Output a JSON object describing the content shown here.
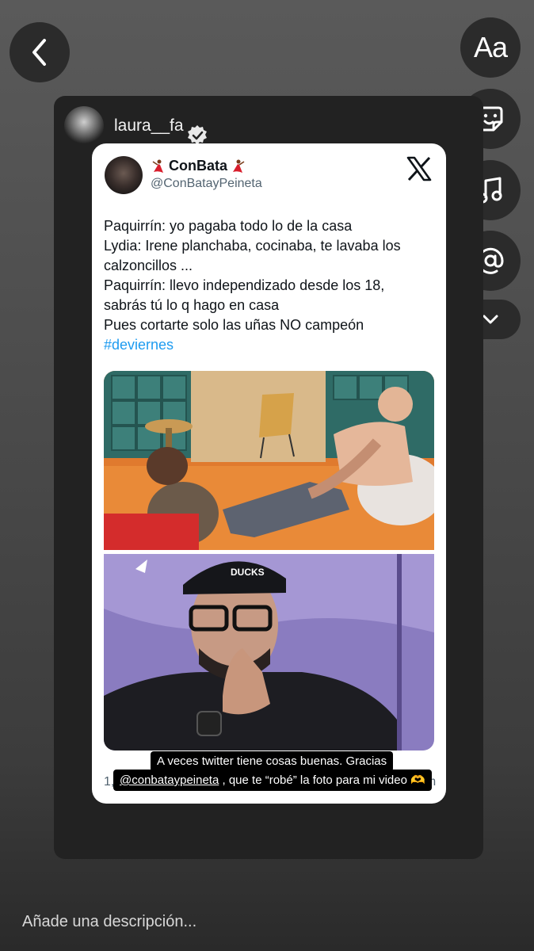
{
  "story": {
    "username": "laura__fa",
    "verified_icon": "verified-badge-icon"
  },
  "toolbar": {
    "back_icon": "chevron-left-icon",
    "text_label": "Aa",
    "sticker_icon": "sticker-icon",
    "music_icon": "music-note-icon",
    "mention_icon": "at-sign-icon",
    "more_icon": "chevron-down-icon"
  },
  "tweet": {
    "display_name": "ConBata",
    "handle": "@ConBatayPeineta",
    "logo_icon": "x-logo-icon",
    "lines": [
      "Paquirrín: yo pagaba todo lo de la casa",
      "Lydia: Irene planchaba, cocinaba, te lavaba los",
      "calzoncillos ...",
      "Paquirrín: llevo independizado desde los 18,",
      "sabrás tú lo q hago en casa",
      "Pues cortarte solo las uñas NO campeón"
    ],
    "hashtag": "#deviernes",
    "image_badge": "DUCKS",
    "footer_left": "1,",
    "footer_right": "com"
  },
  "caption": {
    "line1": "A veces twitter tiene cosas buenas. Gracias",
    "mention": "@conbataypeineta",
    "line2_rest": ", que te “robé” la foto para mi video",
    "emoji": "🫶"
  },
  "description": {
    "placeholder": "Añade una descripción..."
  }
}
